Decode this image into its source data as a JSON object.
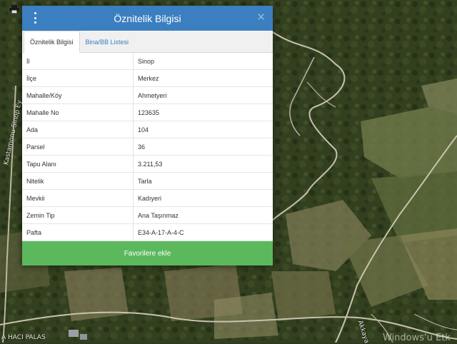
{
  "dialog": {
    "title": "Öznitelik Bilgisi",
    "tabs": [
      {
        "label": "Öznitelik Bilgisi",
        "active": true
      },
      {
        "label": "Bina/BB Listesi",
        "active": false
      }
    ],
    "rows": [
      {
        "key": "İl",
        "value": "Sinop"
      },
      {
        "key": "İlçe",
        "value": "Merkez"
      },
      {
        "key": "Mahalle/Köy",
        "value": "Ahmetyeri"
      },
      {
        "key": "Mahalle No",
        "value": "123635"
      },
      {
        "key": "Ada",
        "value": "104"
      },
      {
        "key": "Parsel",
        "value": "36"
      },
      {
        "key": "Tapu Alanı",
        "value": "3.211,53"
      },
      {
        "key": "Nitelik",
        "value": "Tarla"
      },
      {
        "key": "Mevkii",
        "value": "Kadıyeri"
      },
      {
        "key": "Zemin Tip",
        "value": "Ana Taşınmaz"
      },
      {
        "key": "Pafta",
        "value": "E34-A-17-A-4-C"
      }
    ],
    "favorite_button": "Favorilere ekle"
  },
  "map": {
    "road_label_left": "Kastamonu Sinop Ey",
    "road_label_bottom": "Akkaya",
    "place_label": "A HACI PALAS",
    "watermark": "Windows'u Etk"
  },
  "colors": {
    "header": "#3b7fc1",
    "button": "#5cb85c"
  },
  "icons": {
    "menu": "menu-dots-icon",
    "close": "close-icon",
    "print": "print-icon"
  }
}
